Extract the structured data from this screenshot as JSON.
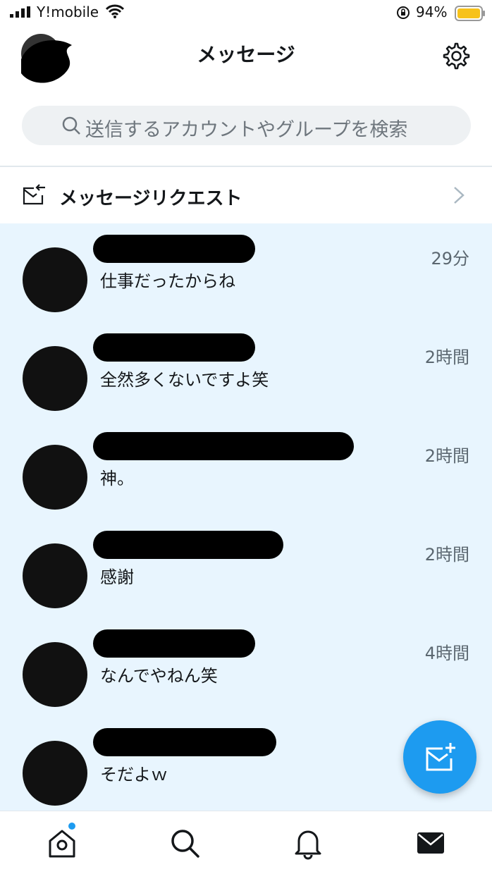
{
  "status_bar": {
    "carrier": "Y!mobile",
    "battery": "94%"
  },
  "header": {
    "title": "メッセージ"
  },
  "search": {
    "placeholder": "送信するアカウントやグループを検索"
  },
  "requests": {
    "label": "メッセージリクエスト"
  },
  "conversations": [
    {
      "time": "29分",
      "preview": "仕事だったからね"
    },
    {
      "time": "2時間",
      "preview": "全然多くないですよ笑"
    },
    {
      "time": "2時間",
      "preview": "神。"
    },
    {
      "time": "2時間",
      "preview": "感謝"
    },
    {
      "time": "4時間",
      "preview": "なんでやねん笑"
    },
    {
      "time": "",
      "preview": "そだよｗ"
    }
  ],
  "colors": {
    "accent": "#1d9bf0",
    "list_background": "#e8f5fe",
    "battery": "#f7c21b"
  },
  "icons": {
    "compose": "new-message-icon",
    "home": "home-icon",
    "search": "search-icon",
    "notifications": "bell-icon",
    "messages": "envelope-icon",
    "settings": "gear-icon"
  }
}
